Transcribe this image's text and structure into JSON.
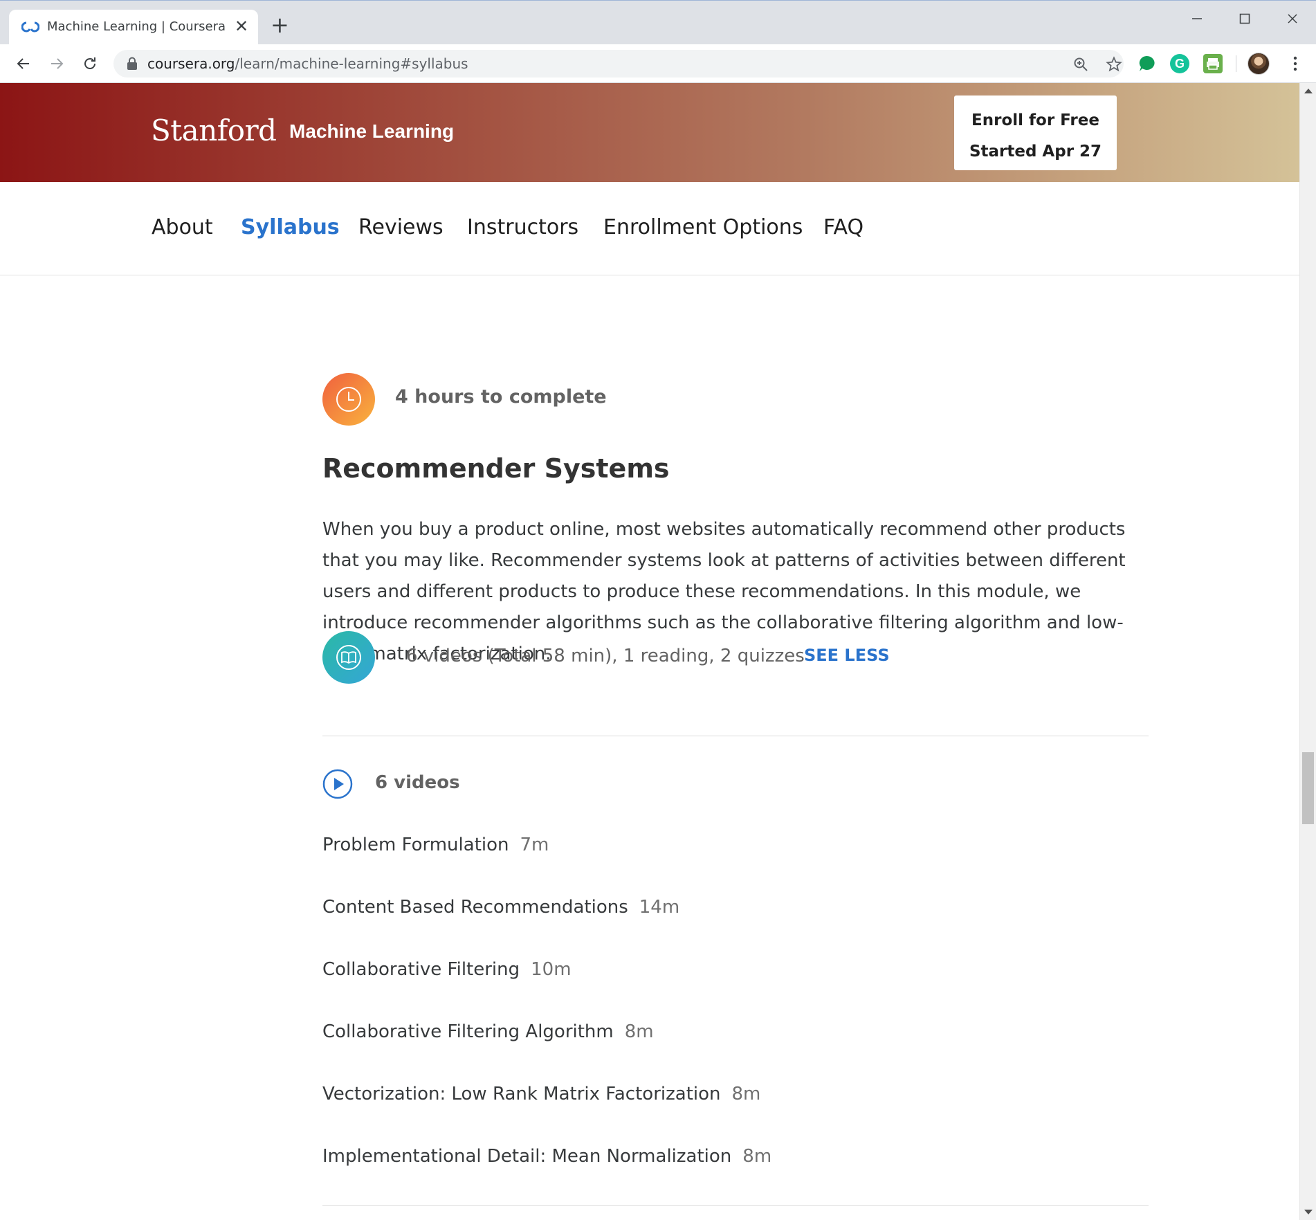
{
  "browser": {
    "tab_title": "Machine Learning | Coursera",
    "url_host": "coursera.org",
    "url_path": "/learn/machine-learning#syllabus"
  },
  "hero": {
    "brand": "Stanford",
    "course_title": "Machine Learning",
    "enroll_line1": "Enroll for Free",
    "enroll_line2": "Started Apr 27"
  },
  "subnav": {
    "items": [
      {
        "label": "About"
      },
      {
        "label": "Syllabus"
      },
      {
        "label": "Reviews"
      },
      {
        "label": "Instructors"
      },
      {
        "label": "Enrollment Options"
      },
      {
        "label": "FAQ"
      }
    ],
    "active": "Syllabus"
  },
  "module": {
    "hours": "4 hours to complete",
    "title": "Recommender Systems",
    "description": "When you buy a product online, most websites automatically recommend other products that you may like. Recommender systems look at patterns of activities between different users and different products to produce these recommendations. In this module, we introduce recommender algorithms such as the collaborative filtering algorithm and low-rank matrix factorization.",
    "stats": "6 videos (Total 58 min), 1 reading, 2 quizzes",
    "see_less": "SEE LESS",
    "videos_heading": "6 videos",
    "videos": [
      {
        "title": "Problem Formulation",
        "duration": "7m"
      },
      {
        "title": "Content Based Recommendations",
        "duration": "14m"
      },
      {
        "title": "Collaborative Filtering",
        "duration": "10m"
      },
      {
        "title": "Collaborative Filtering Algorithm",
        "duration": "8m"
      },
      {
        "title": "Vectorization: Low Rank Matrix Factorization",
        "duration": "8m"
      },
      {
        "title": "Implementational Detail: Mean Normalization",
        "duration": "8m"
      }
    ]
  },
  "colors": {
    "accent_blue": "#2a73cc",
    "stanford_red": "#8c1515",
    "hours_icon": "#f0603e",
    "stats_icon": "#2bb9a6"
  }
}
